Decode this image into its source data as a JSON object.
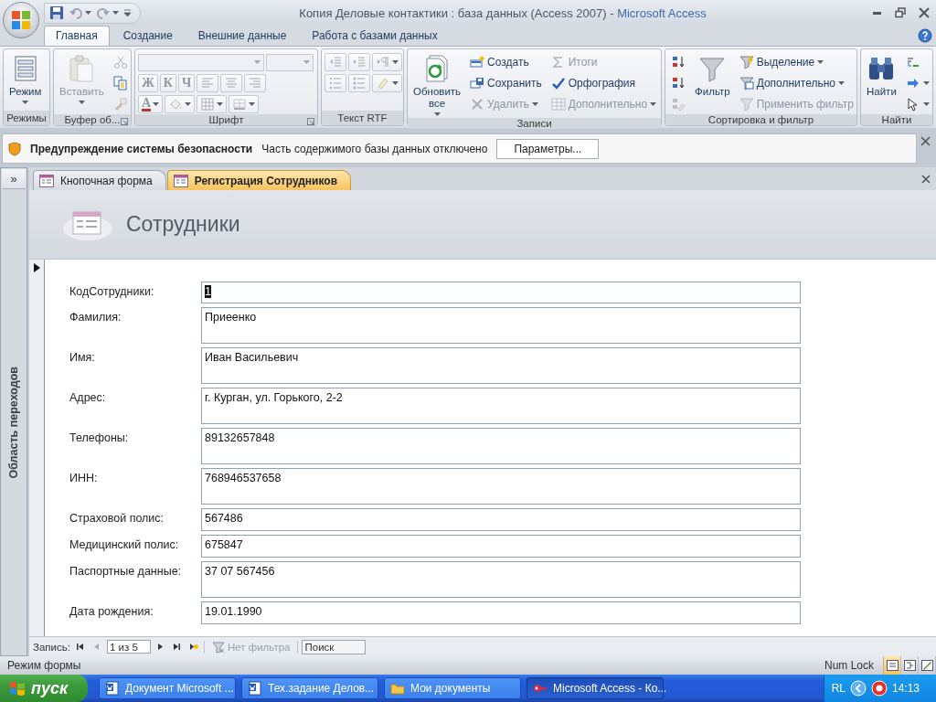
{
  "window": {
    "title": "Копия Деловые контактики : база данных (Access 2007)",
    "separator": "-",
    "app": "Microsoft Access"
  },
  "ribbon_tabs": [
    {
      "label": "Главная",
      "selected": true
    },
    {
      "label": "Создание",
      "selected": false
    },
    {
      "label": "Внешние данные",
      "selected": false
    },
    {
      "label": "Работа с базами данных",
      "selected": false
    }
  ],
  "ribbon_groups": [
    {
      "label": "Режимы",
      "launcher": false,
      "columns": [
        [
          [
            {
              "kind": "large",
              "label": "Режим",
              "disabled": false,
              "dropdown": true
            }
          ]
        ]
      ]
    },
    {
      "label": "Буфер об...",
      "launcher": true,
      "columns": [
        [
          [
            {
              "kind": "large",
              "label": "Вставить",
              "disabled": true,
              "dropdown": true
            }
          ]
        ],
        [
          [
            {
              "kind": "icon",
              "disabled": true,
              "dropdown": false
            }
          ],
          [
            {
              "kind": "icon",
              "disabled": false,
              "dropdown": false
            }
          ],
          [
            {
              "kind": "icon",
              "disabled": true,
              "dropdown": false
            }
          ]
        ]
      ]
    },
    {
      "label": "Шрифт",
      "launcher": true,
      "columns": [
        [
          [
            {
              "kind": "combo",
              "disabled": true
            },
            {
              "kind": "combo",
              "disabled": true
            }
          ],
          [
            {
              "kind": "letter",
              "label": "Ж",
              "disabled": true,
              "dropdown": false
            },
            {
              "kind": "letter",
              "label": "К",
              "disabled": true,
              "dropdown": false
            },
            {
              "kind": "letter",
              "label": "Ч",
              "disabled": true,
              "dropdown": false
            },
            {
              "kind": "icon",
              "disabled": true,
              "dropdown": false
            },
            {
              "kind": "icon",
              "disabled": true,
              "dropdown": false
            },
            {
              "kind": "icon",
              "disabled": true,
              "dropdown": false
            }
          ],
          [
            {
              "kind": "letter",
              "label": "A",
              "disabled": true,
              "dropdown": true
            },
            {
              "kind": "icon",
              "disabled": true,
              "dropdown": true
            },
            {
              "kind": "icon",
              "disabled": true,
              "dropdown": true
            },
            {
              "kind": "icon",
              "disabled": true,
              "dropdown": true
            }
          ]
        ]
      ]
    },
    {
      "label": "Текст RTF",
      "launcher": false,
      "columns": [
        [
          [
            {
              "kind": "icon",
              "disabled": true,
              "dropdown": false
            },
            {
              "kind": "icon",
              "disabled": true,
              "dropdown": false
            },
            {
              "kind": "icon",
              "disabled": true,
              "dropdown": true
            }
          ],
          [
            {
              "kind": "icon",
              "disabled": true,
              "dropdown": false
            },
            {
              "kind": "icon",
              "disabled": true,
              "dropdown": false
            },
            {
              "kind": "icon",
              "disabled": true,
              "dropdown": true
            }
          ]
        ]
      ]
    },
    {
      "label": "Записи",
      "launcher": false,
      "columns": [
        [
          [
            {
              "kind": "large",
              "label": "Обновить все",
              "disabled": false,
              "dropdown": true
            }
          ]
        ],
        [
          [
            {
              "kind": "small",
              "label": "Создать",
              "disabled": false,
              "dropdown": false
            }
          ],
          [
            {
              "kind": "small",
              "label": "Сохранить",
              "disabled": false,
              "dropdown": false
            }
          ],
          [
            {
              "kind": "small",
              "label": "Удалить",
              "disabled": true,
              "dropdown": true
            }
          ]
        ],
        [
          [
            {
              "kind": "small",
              "label": "Итоги",
              "disabled": true,
              "dropdown": false
            }
          ],
          [
            {
              "kind": "small",
              "label": "Орфография",
              "disabled": false,
              "dropdown": false
            }
          ],
          [
            {
              "kind": "small",
              "label": "Дополнительно",
              "disabled": true,
              "dropdown": true
            }
          ]
        ]
      ]
    },
    {
      "label": "Сортировка и фильтр",
      "launcher": false,
      "columns": [
        [
          [
            {
              "kind": "icon",
              "disabled": false,
              "dropdown": false
            }
          ],
          [
            {
              "kind": "icon",
              "disabled": false,
              "dropdown": false
            }
          ],
          [
            {
              "kind": "icon",
              "disabled": true,
              "dropdown": false
            }
          ]
        ],
        [
          [
            {
              "kind": "large",
              "label": "Фильтр",
              "disabled": false,
              "dropdown": false
            }
          ]
        ],
        [
          [
            {
              "kind": "small",
              "label": "Выделение",
              "disabled": false,
              "dropdown": true
            }
          ],
          [
            {
              "kind": "small",
              "label": "Дополнительно",
              "disabled": false,
              "dropdown": true
            }
          ],
          [
            {
              "kind": "small",
              "label": "Применить фильтр",
              "disabled": true,
              "dropdown": false
            }
          ]
        ]
      ]
    },
    {
      "label": "Найти",
      "launcher": false,
      "columns": [
        [
          [
            {
              "kind": "large",
              "label": "Найти",
              "disabled": false,
              "dropdown": false
            }
          ]
        ],
        [
          [
            {
              "kind": "icon",
              "disabled": false,
              "dropdown": false
            }
          ],
          [
            {
              "kind": "icon",
              "disabled": false,
              "dropdown": true
            }
          ],
          [
            {
              "kind": "icon",
              "disabled": false,
              "dropdown": true
            }
          ]
        ]
      ]
    }
  ],
  "security_bar": {
    "title": "Предупреждение системы безопасности",
    "message": "Часть содержимого базы данных отключено",
    "button": "Параметры..."
  },
  "nav_pane": {
    "expand_button": "»",
    "label": "Область переходов"
  },
  "doc_tabs": [
    {
      "label": "Кнопочная форма",
      "selected": false
    },
    {
      "label": "Регистрация Сотрудников",
      "selected": true
    }
  ],
  "form": {
    "title": "Сотрудники",
    "fields": [
      {
        "label": "КодСотрудники:",
        "value": "1",
        "selected": true
      },
      {
        "label": "Фамилия:",
        "value": "Приеенко",
        "selected": false
      },
      {
        "label": "Имя:",
        "value": "Иван Васильевич",
        "selected": false
      },
      {
        "label": "Адрес:",
        "value": "г. Курган, ул. Горького, 2-2",
        "selected": false
      },
      {
        "label": "Телефоны:",
        "value": "89132657848",
        "selected": false
      },
      {
        "label": "ИНН:",
        "value": "768946537658",
        "selected": false
      },
      {
        "label": "Страховой полис:",
        "value": "567486",
        "selected": false
      },
      {
        "label": "Медицинский полис:",
        "value": "675847",
        "selected": false
      },
      {
        "label": "Паспортные данные:",
        "value": "37 07 567456",
        "selected": false
      },
      {
        "label": "Дата рождения:",
        "value": "19.01.1990",
        "selected": false
      }
    ]
  },
  "record_nav": {
    "label": "Запись:",
    "buttons": [
      {
        "disabled": false
      },
      {
        "disabled": true
      },
      {
        "disabled": false
      },
      {
        "disabled": false
      },
      {
        "disabled": false
      }
    ],
    "position": "1 из 5",
    "filter": "Нет фильтра",
    "filter_disabled": true,
    "search_placeholder": "Поиск"
  },
  "status_bar": {
    "text": "Режим формы",
    "num_lock": "Num Lock",
    "views": [
      {
        "selected": true
      },
      {
        "selected": false
      },
      {
        "selected": false
      }
    ]
  },
  "taskbar": {
    "start": "пуск",
    "tasks": [
      {
        "label": "Документ Microsoft ...",
        "kind": "word",
        "selected": false
      },
      {
        "label": "Тех.задание Делов...",
        "kind": "word",
        "selected": false
      },
      {
        "label": "Мои документы",
        "kind": "folder",
        "selected": false
      },
      {
        "label": "Microsoft Access - Ко...",
        "kind": "access",
        "selected": true
      }
    ],
    "language": "RL",
    "clock": "14:13"
  }
}
